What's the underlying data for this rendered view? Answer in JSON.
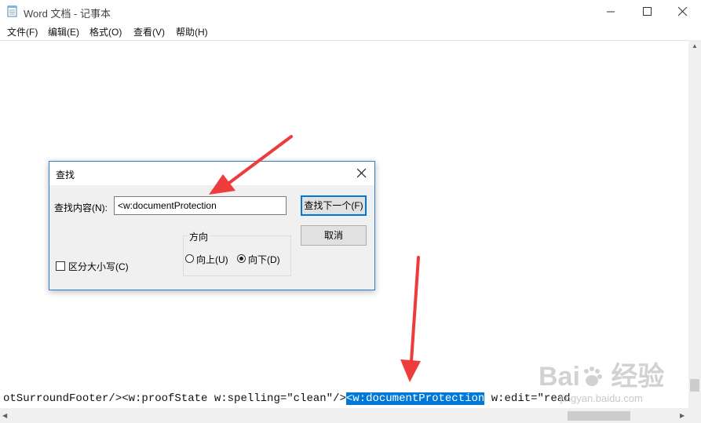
{
  "window": {
    "title": "Word 文档 - 记事本",
    "controls": [
      "minimize-icon",
      "maximize-icon",
      "close-icon"
    ]
  },
  "menu": [
    {
      "label": "文件(F)"
    },
    {
      "label": "编辑(E)"
    },
    {
      "label": "格式(O)"
    },
    {
      "label": "查看(V)"
    },
    {
      "label": "帮助(H)"
    }
  ],
  "editor": {
    "line_before": "otSurroundFooter/><w:proofState w:spelling=\"clean\"/>",
    "highlighted": "<w:documentProtection",
    "line_after": " w:edit=\"read"
  },
  "find_dialog": {
    "title": "查找",
    "find_label": "查找内容(N):",
    "find_value": "<w:documentProtection",
    "find_next_button": "查找下一个(F)",
    "cancel_button": "取消",
    "direction_label": "方向",
    "direction_up": "向上(U)",
    "direction_down": "向下(D)",
    "direction_selected": "down",
    "match_case_label": "区分大小写(C)",
    "match_case_checked": false
  },
  "watermark": {
    "brand": "Bai 经验",
    "url": "jingyan.baidu.com"
  },
  "colors": {
    "selection": "#0078d7",
    "annotation_arrow": "#ee3b3b",
    "dialog_border": "#2e7bd6"
  }
}
